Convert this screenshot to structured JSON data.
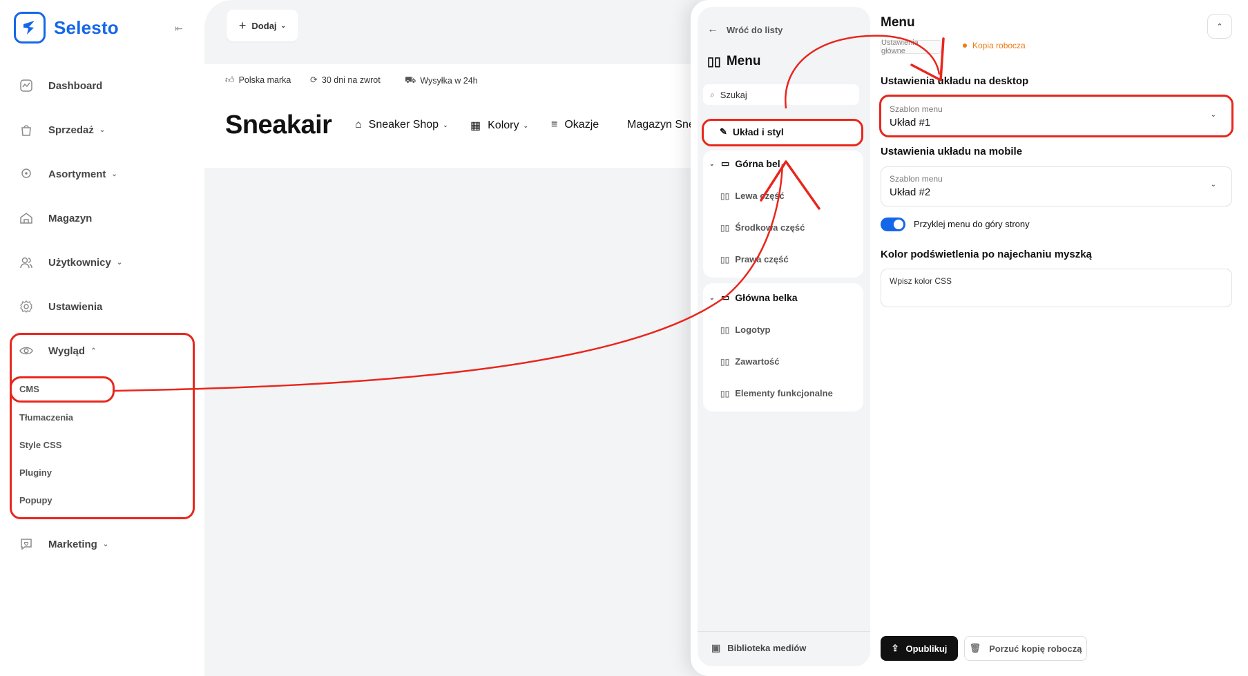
{
  "app": {
    "logo_text": "Selesto"
  },
  "sidebar": {
    "items": [
      {
        "label": "Dashboard"
      },
      {
        "label": "Sprzedaż"
      },
      {
        "label": "Asortyment"
      },
      {
        "label": "Magazyn"
      },
      {
        "label": "Użytkownicy"
      },
      {
        "label": "Ustawienia"
      },
      {
        "label": "Wygląd"
      },
      {
        "label": "Marketing"
      }
    ],
    "sub_items": [
      "CMS",
      "Tłumaczenia",
      "Style CSS",
      "Pluginy",
      "Popupy"
    ]
  },
  "toolbar": {
    "add_label": "Dodaj"
  },
  "preview": {
    "usps": [
      "Polska marka",
      "30 dni na zwrot",
      "Wysyłka w 24h"
    ],
    "brand": "Sneakair",
    "nav": [
      "Sneaker Shop",
      "Kolory",
      "Okazje",
      "Magazyn Snea"
    ]
  },
  "tree": {
    "back_label": "Wróć do listy",
    "title": "Menu",
    "search_value": "Szukaj",
    "layout_style": "Układ i styl",
    "groups": [
      {
        "label": "Górna bel",
        "children": [
          "Lewa część",
          "Środkowa część",
          "Prawa część"
        ]
      },
      {
        "label": "Główna belka",
        "children": [
          "Logotyp",
          "Zawartość",
          "Elementy funkcjonalne"
        ]
      }
    ],
    "media_library": "Biblioteka mediów"
  },
  "form": {
    "title": "Menu",
    "crumb": "Ustawienia główne",
    "draft_status": "Kopia robocza",
    "desktop_section": "Ustawienia układu na desktop",
    "desktop_select_label": "Szablon menu",
    "desktop_select_value": "Układ #1",
    "mobile_section": "Ustawienia układu na mobile",
    "mobile_select_label": "Szablon menu",
    "mobile_select_value": "Układ #2",
    "sticky_label": "Przyklej menu do góry strony",
    "hover_color_section": "Kolor podświetlenia po najechaniu myszką",
    "hover_color_placeholder": "Wpisz kolor CSS",
    "publish_label": "Opublikuj",
    "discard_label": "Porzuć kopię roboczą"
  },
  "colors": {
    "accent": "#1467e8",
    "annotation": "#e8261c",
    "draft": "#ee7a14"
  }
}
